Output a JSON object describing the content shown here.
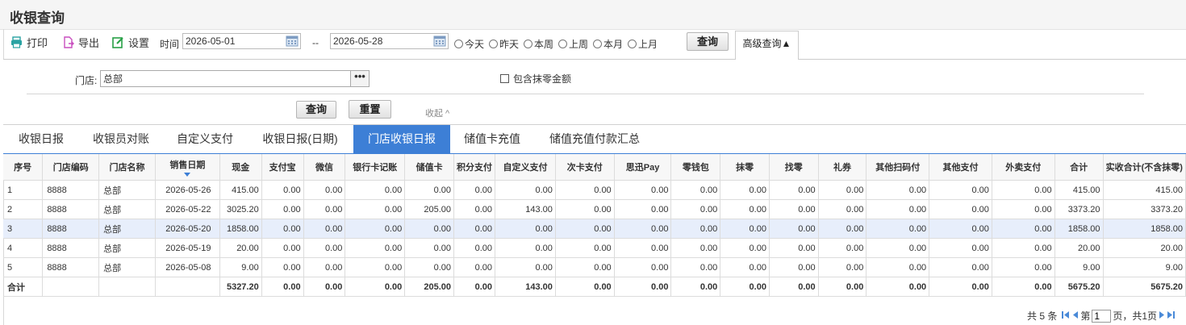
{
  "page": {
    "title": "收银查询"
  },
  "toolbar": {
    "print_label": "打印",
    "export_label": "导出",
    "settings_label": "设置",
    "time_label": "时间",
    "date_from": "2026-05-01",
    "date_sep": "--",
    "date_to": "2026-05-28",
    "quick_ranges": [
      "今天",
      "昨天",
      "本周",
      "上周",
      "本月",
      "上月"
    ],
    "query_label": "查询",
    "advanced_label": "高级查询▲"
  },
  "advanced": {
    "store_label": "门店:",
    "store_value": "总部",
    "store_picker": "•••",
    "include_rounding_label": "包含抹零金额",
    "query_label": "查询",
    "reset_label": "重置",
    "collapse_label": "收起 ^"
  },
  "tabs": [
    "收银日报",
    "收银员对账",
    "自定义支付",
    "收银日报(日期)",
    "门店收银日报",
    "储值卡充值",
    "储值充值付款汇总"
  ],
  "active_tab_index": 4,
  "table": {
    "columns": [
      "序号",
      "门店编码",
      "门店名称",
      "销售日期",
      "现金",
      "支付宝",
      "微信",
      "银行卡记账",
      "储值卡",
      "积分支付",
      "自定义支付",
      "次卡支付",
      "思迅Pay",
      "零钱包",
      "抹零",
      "找零",
      "礼券",
      "其他扫码付",
      "其他支付",
      "外卖支付",
      "合计",
      "实收合计(不含抹零)"
    ],
    "sort_column_index": 3,
    "rows": [
      [
        "1",
        "8888",
        "总部",
        "2026-05-26",
        "415.00",
        "0.00",
        "0.00",
        "0.00",
        "0.00",
        "0.00",
        "0.00",
        "0.00",
        "0.00",
        "0.00",
        "0.00",
        "0.00",
        "0.00",
        "0.00",
        "0.00",
        "0.00",
        "415.00",
        "415.00"
      ],
      [
        "2",
        "8888",
        "总部",
        "2026-05-22",
        "3025.20",
        "0.00",
        "0.00",
        "0.00",
        "205.00",
        "0.00",
        "143.00",
        "0.00",
        "0.00",
        "0.00",
        "0.00",
        "0.00",
        "0.00",
        "0.00",
        "0.00",
        "0.00",
        "3373.20",
        "3373.20"
      ],
      [
        "3",
        "8888",
        "总部",
        "2026-05-20",
        "1858.00",
        "0.00",
        "0.00",
        "0.00",
        "0.00",
        "0.00",
        "0.00",
        "0.00",
        "0.00",
        "0.00",
        "0.00",
        "0.00",
        "0.00",
        "0.00",
        "0.00",
        "0.00",
        "1858.00",
        "1858.00"
      ],
      [
        "4",
        "8888",
        "总部",
        "2026-05-19",
        "20.00",
        "0.00",
        "0.00",
        "0.00",
        "0.00",
        "0.00",
        "0.00",
        "0.00",
        "0.00",
        "0.00",
        "0.00",
        "0.00",
        "0.00",
        "0.00",
        "0.00",
        "0.00",
        "20.00",
        "20.00"
      ],
      [
        "5",
        "8888",
        "总部",
        "2026-05-08",
        "9.00",
        "0.00",
        "0.00",
        "0.00",
        "0.00",
        "0.00",
        "0.00",
        "0.00",
        "0.00",
        "0.00",
        "0.00",
        "0.00",
        "0.00",
        "0.00",
        "0.00",
        "0.00",
        "9.00",
        "9.00"
      ]
    ],
    "selected_row_index": 2,
    "total_row": [
      "合计",
      "",
      "",
      "",
      "5327.20",
      "0.00",
      "0.00",
      "0.00",
      "205.00",
      "0.00",
      "143.00",
      "0.00",
      "0.00",
      "0.00",
      "0.00",
      "0.00",
      "0.00",
      "0.00",
      "0.00",
      "0.00",
      "5675.20",
      "5675.20"
    ]
  },
  "pager": {
    "total_text": "共 5 条",
    "page_prefix": "第",
    "page_value": "1",
    "page_suffix": "页，共1页"
  },
  "colors": {
    "accent": "#3d7fd6",
    "selected_row": "#e7eefb",
    "icon_teal": "#2aa3a3",
    "icon_pink": "#c94fbf",
    "icon_green": "#27a046"
  }
}
